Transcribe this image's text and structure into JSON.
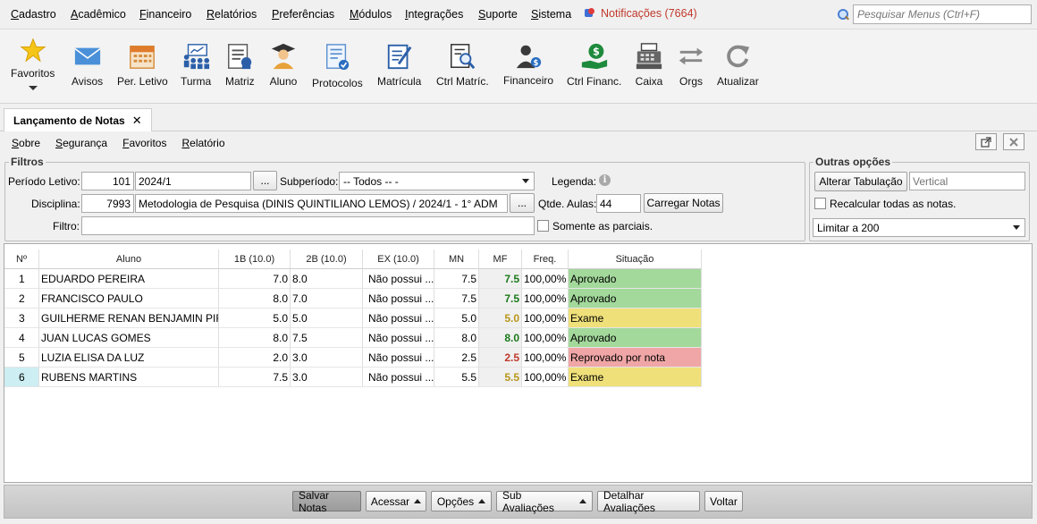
{
  "menu": [
    "Cadastro",
    "Acadêmico",
    "Financeiro",
    "Relatórios",
    "Preferências",
    "Módulos",
    "Integrações",
    "Suporte",
    "Sistema"
  ],
  "notifications": "Notificações (7664)",
  "search": {
    "placeholder": "Pesquisar Menus (Ctrl+F)"
  },
  "toolbar": [
    {
      "label": "Favoritos",
      "icon": "star-icon"
    },
    {
      "label": "Avisos",
      "icon": "envelope-icon"
    },
    {
      "label": "Per. Letivo",
      "icon": "calendar-icon"
    },
    {
      "label": "Turma",
      "icon": "classroom-icon"
    },
    {
      "label": "Matriz",
      "icon": "matrix-icon"
    },
    {
      "label": "Aluno",
      "icon": "student-icon"
    },
    {
      "label": "Protocolos",
      "icon": "protocol-icon"
    },
    {
      "label": "Matrícula",
      "icon": "enrollment-icon"
    },
    {
      "label": "Ctrl Matríc.",
      "icon": "enrollment-control-icon"
    },
    {
      "label": "Financeiro",
      "icon": "finance-user-icon"
    },
    {
      "label": "Ctrl Financ.",
      "icon": "money-hand-icon"
    },
    {
      "label": "Caixa",
      "icon": "cash-register-icon"
    },
    {
      "label": "Orgs",
      "icon": "swap-arrows-icon"
    },
    {
      "label": "Atualizar",
      "icon": "refresh-icon"
    }
  ],
  "tab": {
    "title": "Lançamento de Notas",
    "close": "✕"
  },
  "submenu": [
    "Sobre",
    "Segurança",
    "Favoritos",
    "Relatório"
  ],
  "filtros": {
    "title": "Filtros",
    "periodo_label": "Período Letivo:",
    "periodo_code": "101",
    "periodo_name": "2024/1",
    "subperiodo_label": "Subperíodo:",
    "subperiodo_value": "-- Todos -- -",
    "legenda_label": "Legenda:",
    "disciplina_label": "Disciplina:",
    "disciplina_code": "7993",
    "disciplina_name": "Metodologia de Pesquisa (DINIS QUINTILIANO LEMOS) / 2024/1 - 1° ADM",
    "qtde_label": "Qtde. Aulas:",
    "qtde_value": "44",
    "carregar": "Carregar Notas",
    "filtro_label": "Filtro:",
    "filtro_value": "",
    "somente": "Somente as parciais.",
    "ellipsis": "..."
  },
  "outras": {
    "title": "Outras opções",
    "alterar": "Alterar Tabulação",
    "vertical_placeholder": "Vertical",
    "recalcular": "Recalcular todas as notas.",
    "limitar": "Limitar a 200"
  },
  "grid": {
    "headers": [
      "Nº",
      "Aluno",
      "1B (10.0)",
      "2B (10.0)",
      "EX (10.0)",
      "MN",
      "MF",
      "Freq.",
      "Situação"
    ],
    "rows": [
      {
        "n": "1",
        "aluno": "EDUARDO PEREIRA",
        "b1": "7.0",
        "b2": "8.0",
        "ex": "Não possui ...",
        "mn": "7.5",
        "mf": "7.5",
        "freq": "100,00%",
        "sit": "Aprovado",
        "mf_color": "#1a7a1a",
        "sit_color": "#a3d99b"
      },
      {
        "n": "2",
        "aluno": "FRANCISCO PAULO",
        "b1": "8.0",
        "b2": "7.0",
        "ex": "Não possui ...",
        "mn": "7.5",
        "mf": "7.5",
        "freq": "100,00%",
        "sit": "Aprovado",
        "mf_color": "#1a7a1a",
        "sit_color": "#a3d99b"
      },
      {
        "n": "3",
        "aluno": "GUILHERME RENAN BENJAMIN PIR...",
        "b1": "5.0",
        "b2": "5.0",
        "ex": "Não possui ...",
        "mn": "5.0",
        "mf": "5.0",
        "freq": "100,00%",
        "sit": "Exame",
        "mf_color": "#b8961a",
        "sit_color": "#efe07a"
      },
      {
        "n": "4",
        "aluno": "JUAN LUCAS GOMES",
        "b1": "8.0",
        "b2": "7.5",
        "ex": "Não possui ...",
        "mn": "8.0",
        "mf": "8.0",
        "freq": "100,00%",
        "sit": "Aprovado",
        "mf_color": "#1a7a1a",
        "sit_color": "#a3d99b"
      },
      {
        "n": "5",
        "aluno": "LUZIA ELISA DA LUZ",
        "b1": "2.0",
        "b2": "3.0",
        "ex": "Não possui ...",
        "mn": "2.5",
        "mf": "2.5",
        "freq": "100,00%",
        "sit": "Reprovado por nota",
        "mf_color": "#c0392b",
        "sit_color": "#f0a6a6"
      },
      {
        "n": "6",
        "aluno": "RUBENS MARTINS",
        "b1": "7.5",
        "b2": "3.0",
        "ex": "Não possui ...",
        "mn": "5.5",
        "mf": "5.5",
        "freq": "100,00%",
        "sit": "Exame",
        "mf_color": "#b8961a",
        "sit_color": "#efe07a"
      }
    ],
    "selected_row": "6",
    "selected_color": "#cdeef2"
  },
  "bottom": {
    "salvar": "Salvar Notas",
    "acessar": "Acessar",
    "opcoes": "Opções",
    "sub": "Sub Avaliações",
    "detalhar": "Detalhar Avaliações",
    "voltar": "Voltar"
  }
}
